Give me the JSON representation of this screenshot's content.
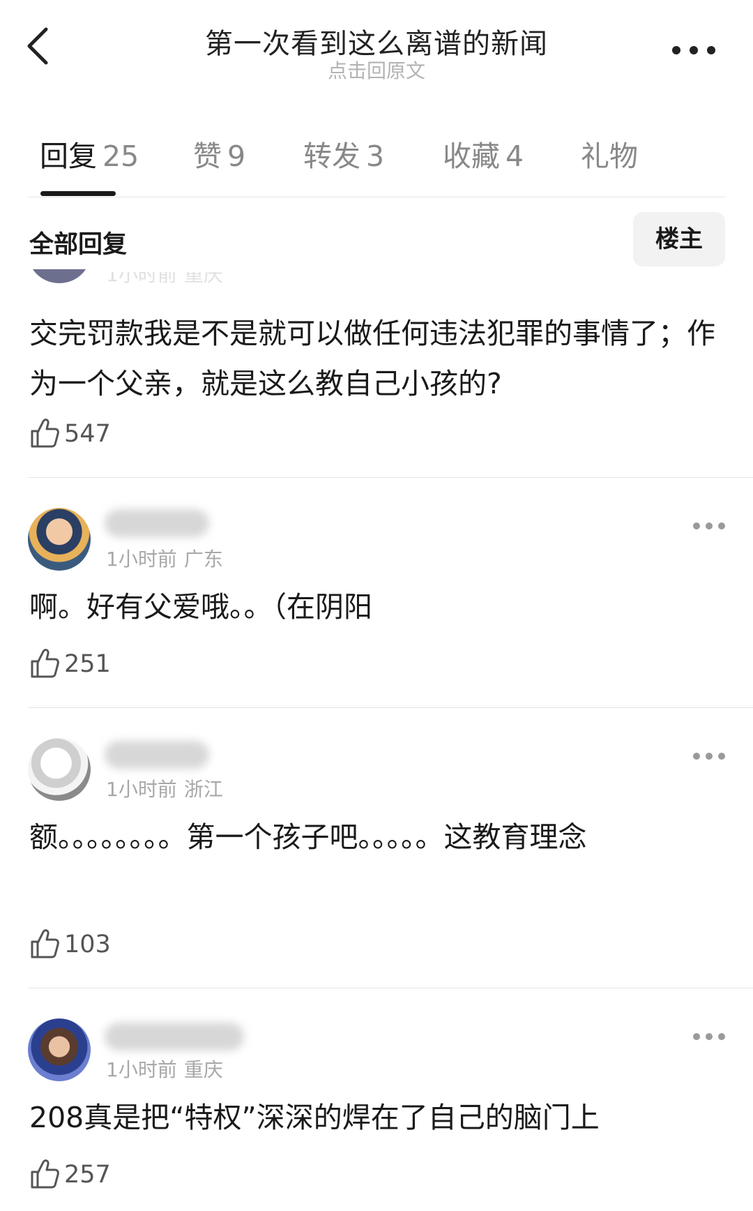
{
  "header": {
    "title": "第一次看到这么离谱的新闻",
    "subtitle": "点击回原文"
  },
  "tabs": [
    {
      "label": "回复",
      "count": "25",
      "active": true
    },
    {
      "label": "赞",
      "count": "9"
    },
    {
      "label": "转发",
      "count": "3"
    },
    {
      "label": "收藏",
      "count": "4"
    },
    {
      "label": "礼物",
      "count": ""
    }
  ],
  "section": {
    "title": "全部回复",
    "owner_button": "楼主"
  },
  "comments": [
    {
      "time": "1小时前",
      "location": "重庆",
      "text": "交完罚款我是不是就可以做任何违法犯罪的事情了；作为一个父亲，就是这么教自己小孩的?",
      "likes": "547",
      "meta_partially_hidden": true
    },
    {
      "time": "1小时前",
      "location": "广东",
      "text": "啊。好有父爱哦。。（在阴阳",
      "likes": "251"
    },
    {
      "time": "1小时前",
      "location": "浙江",
      "text": "额。。。。。。。。第一个孩子吧。。。。。这教育理念",
      "likes": "103"
    },
    {
      "time": "1小时前",
      "location": "重庆",
      "text": "208真是把“特权”深深的焊在了自己的脑门上",
      "likes": "257"
    }
  ],
  "icons": {
    "back": "chevron-left-icon",
    "more": "more-horizontal-icon",
    "like": "thumbs-up-icon"
  },
  "colors": {
    "text_primary": "#1a1a1a",
    "text_muted": "#a8a8a8",
    "divider": "#e4e4e4",
    "button_bg": "#f2f2f2"
  }
}
